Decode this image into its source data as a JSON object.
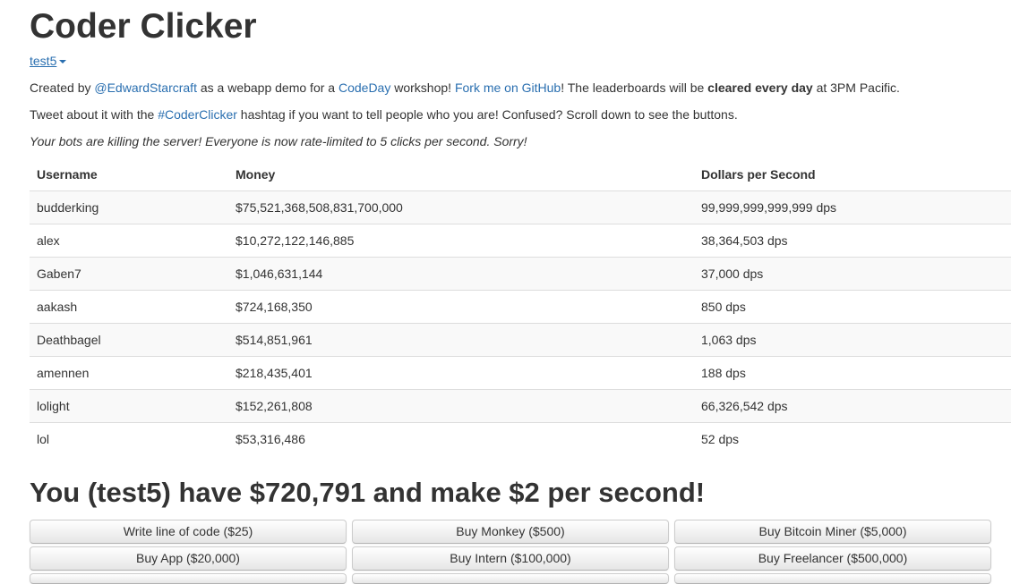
{
  "header": {
    "title": "Coder Clicker",
    "user_menu_label": "test5"
  },
  "intro": {
    "p1_created_by": "Created by ",
    "p1_author_link": "@EdwardStarcraft",
    "p1_mid": " as a webapp demo for a ",
    "p1_codeday_link": "CodeDay",
    "p1_workshop": " workshop! ",
    "p1_github_link": "Fork me on GitHub",
    "p1_leaderboard": "! The leaderboards will be ",
    "p1_cleared": "cleared every day",
    "p1_time": " at 3PM Pacific.",
    "p2_start": "Tweet about it with the ",
    "p2_hashtag_link": "#CoderClicker",
    "p2_end": " hashtag if you want to tell people who you are! Confused? Scroll down to see the buttons.",
    "p3_notice": "Your bots are killing the server! Everyone is now rate-limited to 5 clicks per second. Sorry!"
  },
  "leaderboard": {
    "columns": [
      "Username",
      "Money",
      "Dollars per Second"
    ],
    "rows": [
      {
        "username": "budderking",
        "money": "$75,521,368,508,831,700,000",
        "dps": "99,999,999,999,999 dps"
      },
      {
        "username": "alex",
        "money": "$10,272,122,146,885",
        "dps": "38,364,503 dps"
      },
      {
        "username": "Gaben7",
        "money": "$1,046,631,144",
        "dps": "37,000 dps"
      },
      {
        "username": "aakash",
        "money": "$724,168,350",
        "dps": "850 dps"
      },
      {
        "username": "Deathbagel",
        "money": "$514,851,961",
        "dps": "1,063 dps"
      },
      {
        "username": "amennen",
        "money": "$218,435,401",
        "dps": "188 dps"
      },
      {
        "username": "lolight",
        "money": "$152,261,808",
        "dps": "66,326,542 dps"
      },
      {
        "username": "lol",
        "money": "$53,316,486",
        "dps": "52 dps"
      }
    ]
  },
  "summary": {
    "text": "You (test5) have $720,791 and make $2 per second!"
  },
  "buttons": [
    {
      "label": "Write line of code ($25)"
    },
    {
      "label": "Buy Monkey ($500)"
    },
    {
      "label": "Buy Bitcoin Miner ($5,000)"
    },
    {
      "label": "Buy App ($20,000)"
    },
    {
      "label": "Buy Intern ($100,000)"
    },
    {
      "label": "Buy Freelancer ($500,000)"
    }
  ],
  "colors": {
    "link": "#2a6fb0",
    "text": "#333333",
    "row_stripe": "#f9f9f9",
    "border": "#dddddd"
  }
}
